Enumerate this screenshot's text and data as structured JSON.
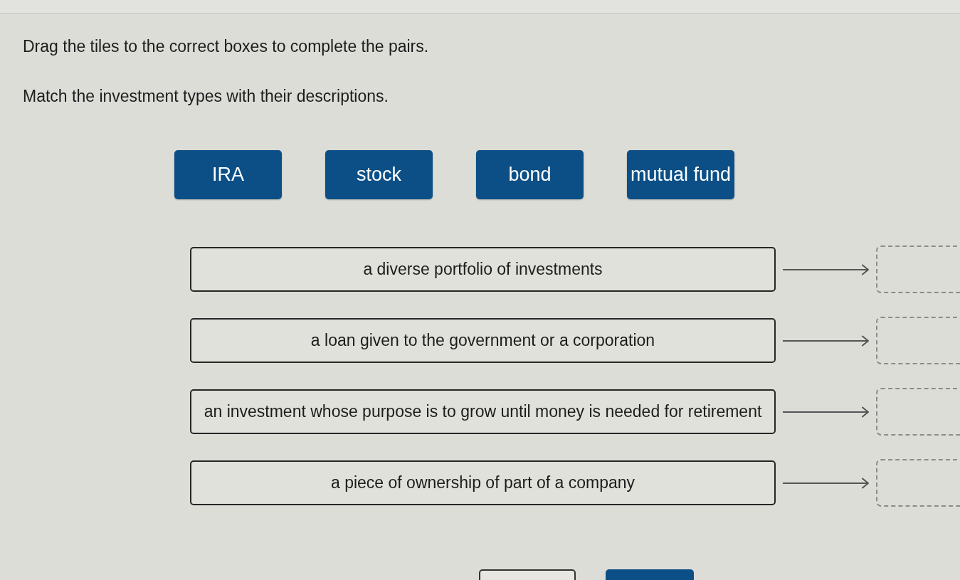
{
  "instructions": [
    "Drag the tiles to the correct boxes to complete the pairs.",
    "Match the investment types with their descriptions."
  ],
  "tiles": [
    "IRA",
    "stock",
    "bond",
    "mutual fund"
  ],
  "pairs": [
    {
      "description": "a diverse portfolio of investments"
    },
    {
      "description": "a loan given to the government or a corporation"
    },
    {
      "description": "an investment whose purpose is to grow until money is needed for retirement"
    },
    {
      "description": "a piece of ownership of part of a company"
    }
  ],
  "buttons": [
    {
      "kind": "outline"
    },
    {
      "kind": "filled"
    }
  ]
}
